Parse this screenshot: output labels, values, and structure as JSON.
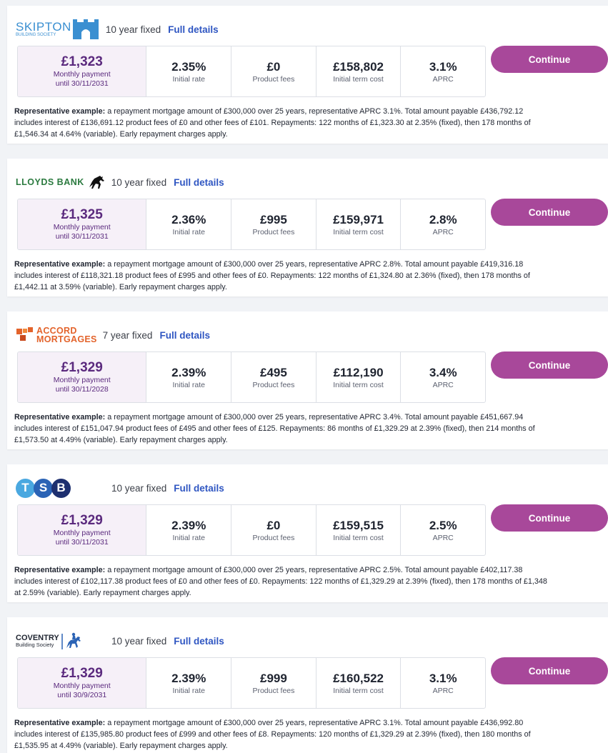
{
  "deals": [
    {
      "lender": "skipton",
      "logo_text": "SKIPTON",
      "logo_sub": "BUILDING SOCIETY",
      "term": "10 year fixed",
      "details_label": "Full details",
      "monthly": "£1,323",
      "monthly_label": "Monthly payment",
      "until": "until 30/11/2031",
      "rate": "2.35%",
      "rate_label": "Initial rate",
      "fees": "£0",
      "fees_label": "Product fees",
      "cost": "£158,802",
      "cost_label": "Initial term cost",
      "aprc": "3.1%",
      "aprc_label": "APRC",
      "continue_label": "Continue",
      "rep_bold": "Representative example:",
      "rep_line1": " a repayment mortgage amount of £300,000 over 25 years, representative APRC 3.1%. Total amount payable £436,792.12",
      "rep_line2": "includes interest of £136,691.12 product fees of £0 and other fees of £101. Repayments: 122 months of £1,323.30 at 2.35% (fixed), then 178 months of",
      "rep_line3": "£1,546.34 at 4.64% (variable). Early repayment charges apply."
    },
    {
      "lender": "lloyds",
      "logo_text": "LLOYDS BANK",
      "logo_sub": "",
      "term": "10 year fixed",
      "details_label": "Full details",
      "monthly": "£1,325",
      "monthly_label": "Monthly payment",
      "until": "until 30/11/2031",
      "rate": "2.36%",
      "rate_label": "Initial rate",
      "fees": "£995",
      "fees_label": "Product fees",
      "cost": "£159,971",
      "cost_label": "Initial term cost",
      "aprc": "2.8%",
      "aprc_label": "APRC",
      "continue_label": "Continue",
      "rep_bold": "Representative example:",
      "rep_line1": " a repayment mortgage amount of £300,000 over 25 years, representative APRC 2.8%. Total amount payable £419,316.18",
      "rep_line2": "includes interest of £118,321.18 product fees of £995 and other fees of £0. Repayments: 122 months of £1,324.80 at 2.36% (fixed), then 178 months of",
      "rep_line3": "£1,442.11 at 3.59% (variable). Early repayment charges apply."
    },
    {
      "lender": "accord",
      "logo_text": "ACCORD",
      "logo_sub": "MORTGAGES",
      "term": "7 year fixed",
      "details_label": "Full details",
      "monthly": "£1,329",
      "monthly_label": "Monthly payment",
      "until": "until 30/11/2028",
      "rate": "2.39%",
      "rate_label": "Initial rate",
      "fees": "£495",
      "fees_label": "Product fees",
      "cost": "£112,190",
      "cost_label": "Initial term cost",
      "aprc": "3.4%",
      "aprc_label": "APRC",
      "continue_label": "Continue",
      "rep_bold": "Representative example:",
      "rep_line1": " a repayment mortgage amount of £300,000 over 25 years, representative APRC 3.4%. Total amount payable £451,667.94",
      "rep_line2": "includes interest of £151,047.94 product fees of £495 and other fees of £125. Repayments: 86 months of £1,329.29 at 2.39% (fixed), then 214 months of",
      "rep_line3": "£1,573.50 at 4.49% (variable). Early repayment charges apply."
    },
    {
      "lender": "tsb",
      "logo_text": "TSB",
      "logo_sub": "",
      "term": "10 year fixed",
      "details_label": "Full details",
      "monthly": "£1,329",
      "monthly_label": "Monthly payment",
      "until": "until 30/11/2031",
      "rate": "2.39%",
      "rate_label": "Initial rate",
      "fees": "£0",
      "fees_label": "Product fees",
      "cost": "£159,515",
      "cost_label": "Initial term cost",
      "aprc": "2.5%",
      "aprc_label": "APRC",
      "continue_label": "Continue",
      "rep_bold": "Representative example:",
      "rep_line1": " a repayment mortgage amount of £300,000 over 25 years, representative APRC 2.5%. Total amount payable £402,117.38",
      "rep_line2": "includes interest of £102,117.38 product fees of £0 and other fees of £0. Repayments: 122 months of £1,329.29 at 2.39% (fixed), then 178 months of £1,348",
      "rep_line3": "at 2.59% (variable). Early repayment charges apply."
    },
    {
      "lender": "coventry",
      "logo_text": "COVENTRY",
      "logo_sub": "Building Society",
      "term": "10 year fixed",
      "details_label": "Full details",
      "monthly": "£1,329",
      "monthly_label": "Monthly payment",
      "until": "until 30/9/2031",
      "rate": "2.39%",
      "rate_label": "Initial rate",
      "fees": "£999",
      "fees_label": "Product fees",
      "cost": "£160,522",
      "cost_label": "Initial term cost",
      "aprc": "3.1%",
      "aprc_label": "APRC",
      "continue_label": "Continue",
      "rep_bold": "Representative example:",
      "rep_line1": " a repayment mortgage amount of £300,000 over 25 years, representative APRC 3.1%. Total amount payable £436,992.80",
      "rep_line2": "includes interest of £135,985.80 product fees of £999 and other fees of £8. Repayments: 120 months of £1,329.29 at 2.39% (fixed), then 180 months of",
      "rep_line3": "£1,535.95 at 4.49% (variable). Early repayment charges apply."
    }
  ],
  "colors": {
    "brand_purple": "#a8489a",
    "monthly_bg": "#f6f0f8",
    "link_blue": "#2f56c2",
    "tsb_t": "#4aa8e0",
    "tsb_s": "#2b63b5",
    "tsb_b": "#1d2f6f"
  }
}
